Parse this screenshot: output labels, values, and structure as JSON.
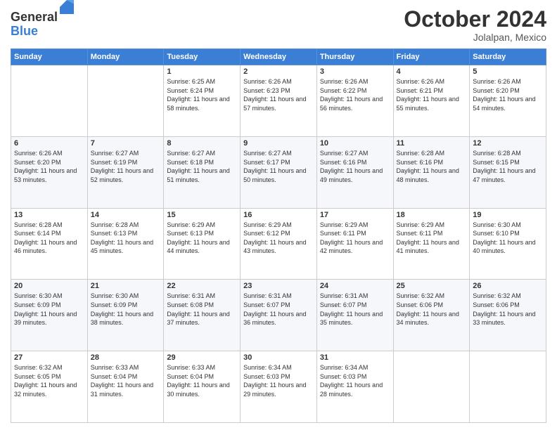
{
  "logo": {
    "general": "General",
    "blue": "Blue"
  },
  "header": {
    "month": "October 2024",
    "location": "Jolalpan, Mexico"
  },
  "days": [
    "Sunday",
    "Monday",
    "Tuesday",
    "Wednesday",
    "Thursday",
    "Friday",
    "Saturday"
  ],
  "weeks": [
    [
      {
        "day": "",
        "info": ""
      },
      {
        "day": "",
        "info": ""
      },
      {
        "day": "1",
        "info": "Sunrise: 6:25 AM\nSunset: 6:24 PM\nDaylight: 11 hours and 58 minutes."
      },
      {
        "day": "2",
        "info": "Sunrise: 6:26 AM\nSunset: 6:23 PM\nDaylight: 11 hours and 57 minutes."
      },
      {
        "day": "3",
        "info": "Sunrise: 6:26 AM\nSunset: 6:22 PM\nDaylight: 11 hours and 56 minutes."
      },
      {
        "day": "4",
        "info": "Sunrise: 6:26 AM\nSunset: 6:21 PM\nDaylight: 11 hours and 55 minutes."
      },
      {
        "day": "5",
        "info": "Sunrise: 6:26 AM\nSunset: 6:20 PM\nDaylight: 11 hours and 54 minutes."
      }
    ],
    [
      {
        "day": "6",
        "info": "Sunrise: 6:26 AM\nSunset: 6:20 PM\nDaylight: 11 hours and 53 minutes."
      },
      {
        "day": "7",
        "info": "Sunrise: 6:27 AM\nSunset: 6:19 PM\nDaylight: 11 hours and 52 minutes."
      },
      {
        "day": "8",
        "info": "Sunrise: 6:27 AM\nSunset: 6:18 PM\nDaylight: 11 hours and 51 minutes."
      },
      {
        "day": "9",
        "info": "Sunrise: 6:27 AM\nSunset: 6:17 PM\nDaylight: 11 hours and 50 minutes."
      },
      {
        "day": "10",
        "info": "Sunrise: 6:27 AM\nSunset: 6:16 PM\nDaylight: 11 hours and 49 minutes."
      },
      {
        "day": "11",
        "info": "Sunrise: 6:28 AM\nSunset: 6:16 PM\nDaylight: 11 hours and 48 minutes."
      },
      {
        "day": "12",
        "info": "Sunrise: 6:28 AM\nSunset: 6:15 PM\nDaylight: 11 hours and 47 minutes."
      }
    ],
    [
      {
        "day": "13",
        "info": "Sunrise: 6:28 AM\nSunset: 6:14 PM\nDaylight: 11 hours and 46 minutes."
      },
      {
        "day": "14",
        "info": "Sunrise: 6:28 AM\nSunset: 6:13 PM\nDaylight: 11 hours and 45 minutes."
      },
      {
        "day": "15",
        "info": "Sunrise: 6:29 AM\nSunset: 6:13 PM\nDaylight: 11 hours and 44 minutes."
      },
      {
        "day": "16",
        "info": "Sunrise: 6:29 AM\nSunset: 6:12 PM\nDaylight: 11 hours and 43 minutes."
      },
      {
        "day": "17",
        "info": "Sunrise: 6:29 AM\nSunset: 6:11 PM\nDaylight: 11 hours and 42 minutes."
      },
      {
        "day": "18",
        "info": "Sunrise: 6:29 AM\nSunset: 6:11 PM\nDaylight: 11 hours and 41 minutes."
      },
      {
        "day": "19",
        "info": "Sunrise: 6:30 AM\nSunset: 6:10 PM\nDaylight: 11 hours and 40 minutes."
      }
    ],
    [
      {
        "day": "20",
        "info": "Sunrise: 6:30 AM\nSunset: 6:09 PM\nDaylight: 11 hours and 39 minutes."
      },
      {
        "day": "21",
        "info": "Sunrise: 6:30 AM\nSunset: 6:09 PM\nDaylight: 11 hours and 38 minutes."
      },
      {
        "day": "22",
        "info": "Sunrise: 6:31 AM\nSunset: 6:08 PM\nDaylight: 11 hours and 37 minutes."
      },
      {
        "day": "23",
        "info": "Sunrise: 6:31 AM\nSunset: 6:07 PM\nDaylight: 11 hours and 36 minutes."
      },
      {
        "day": "24",
        "info": "Sunrise: 6:31 AM\nSunset: 6:07 PM\nDaylight: 11 hours and 35 minutes."
      },
      {
        "day": "25",
        "info": "Sunrise: 6:32 AM\nSunset: 6:06 PM\nDaylight: 11 hours and 34 minutes."
      },
      {
        "day": "26",
        "info": "Sunrise: 6:32 AM\nSunset: 6:06 PM\nDaylight: 11 hours and 33 minutes."
      }
    ],
    [
      {
        "day": "27",
        "info": "Sunrise: 6:32 AM\nSunset: 6:05 PM\nDaylight: 11 hours and 32 minutes."
      },
      {
        "day": "28",
        "info": "Sunrise: 6:33 AM\nSunset: 6:04 PM\nDaylight: 11 hours and 31 minutes."
      },
      {
        "day": "29",
        "info": "Sunrise: 6:33 AM\nSunset: 6:04 PM\nDaylight: 11 hours and 30 minutes."
      },
      {
        "day": "30",
        "info": "Sunrise: 6:34 AM\nSunset: 6:03 PM\nDaylight: 11 hours and 29 minutes."
      },
      {
        "day": "31",
        "info": "Sunrise: 6:34 AM\nSunset: 6:03 PM\nDaylight: 11 hours and 28 minutes."
      },
      {
        "day": "",
        "info": ""
      },
      {
        "day": "",
        "info": ""
      }
    ]
  ]
}
